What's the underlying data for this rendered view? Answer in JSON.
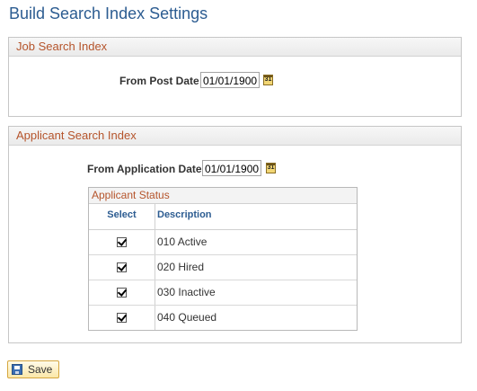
{
  "page": {
    "title": "Build Search Index Settings"
  },
  "job_search": {
    "header": "Job Search Index",
    "from_post_date_label": "From Post Date",
    "from_post_date_value": "01/01/1900",
    "calendar_icon": "calendar-icon"
  },
  "applicant_search": {
    "header": "Applicant Search Index",
    "from_application_date_label": "From Application Date",
    "from_application_date_value": "01/01/1900",
    "calendar_icon": "calendar-icon",
    "status_grid": {
      "title": "Applicant Status",
      "columns": [
        "Select",
        "Description"
      ],
      "rows": [
        {
          "selected": true,
          "description": "010 Active"
        },
        {
          "selected": true,
          "description": "020 Hired"
        },
        {
          "selected": true,
          "description": "030 Inactive"
        },
        {
          "selected": true,
          "description": "040 Queued"
        }
      ]
    }
  },
  "toolbar": {
    "save_label": "Save",
    "save_icon": "save-icon"
  },
  "colors": {
    "title": "#2c5c91",
    "section_header": "#b5542b",
    "button_border": "#d5a63e"
  }
}
